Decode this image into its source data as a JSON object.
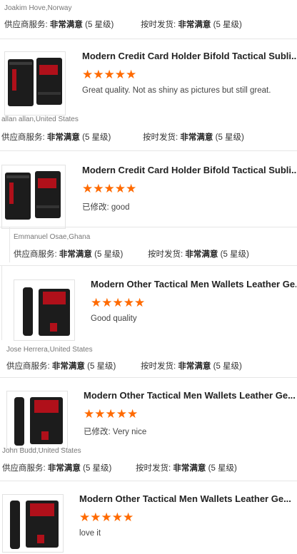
{
  "labels": {
    "supplier_service": "供应商服务:",
    "on_time_shipping": "按时发货:",
    "very_satisfied": "非常满意",
    "five_star": "(5 星级)",
    "edited_prefix": "已修改:"
  },
  "reviews": [
    {
      "reviewer": "Joakim Hove,Norway",
      "product_title": "",
      "stars": "★★★★★",
      "rating": 5,
      "text": ""
    },
    {
      "reviewer": "allan allan,United States",
      "product_title": "Modern Credit Card Holder Bifold Tactical Subli...",
      "stars": "★★★★★",
      "rating": 5,
      "text": "Great quality. Not as shiny as pictures but still great."
    },
    {
      "reviewer": "",
      "product_title": "Modern Credit Card Holder Bifold Tactical Subli...",
      "stars": "★★★★★",
      "rating": 5,
      "text": "good",
      "edited": true
    },
    {
      "reviewer": "Emmanuel Osae,Ghana",
      "product_title": "Modern Other Tactical Men Wallets Leather Ge...",
      "stars": "★★★★★",
      "rating": 5,
      "text": "Good quality"
    },
    {
      "reviewer": "Jose Herrera,United States",
      "product_title": "Modern Other Tactical Men Wallets Leather Ge...",
      "stars": "★★★★★",
      "rating": 5,
      "text": "Very nice",
      "edited": true
    },
    {
      "reviewer": "John Budd,United States",
      "product_title": "Modern Other Tactical Men Wallets Leather Ge...",
      "stars": "★★★★★",
      "rating": 5,
      "text": "love it"
    }
  ],
  "colors": {
    "star": "#ff6a00",
    "divider": "#e6e6e6",
    "wallet_black": "#1c1c1c",
    "wallet_red": "#b0101a"
  }
}
